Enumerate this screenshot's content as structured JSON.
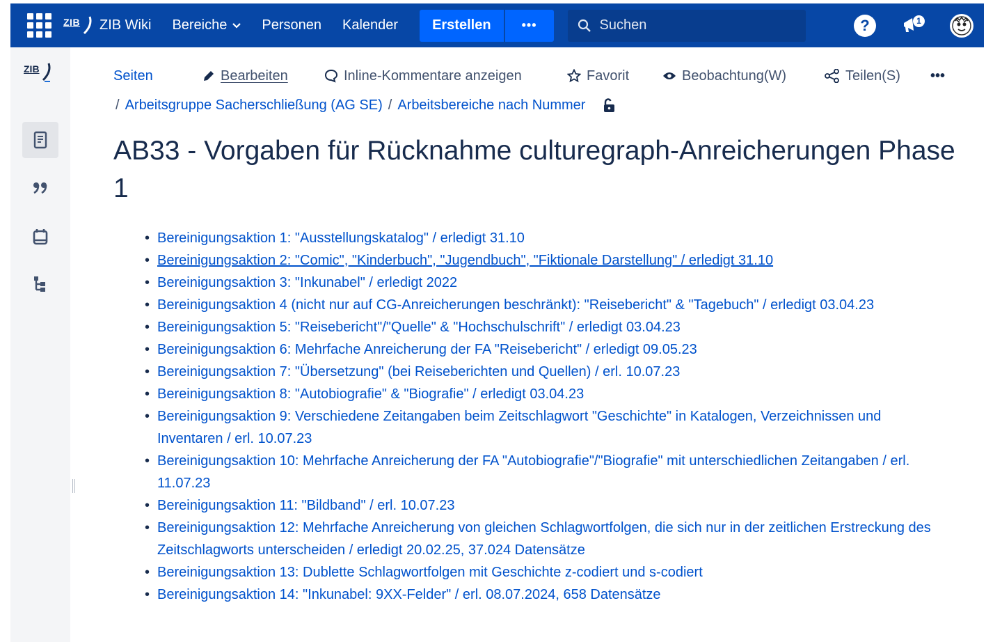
{
  "topnav": {
    "logo_text": "ZIB",
    "site_name": "ZIB Wiki",
    "areas_label": "Bereiche",
    "people_label": "Personen",
    "calendar_label": "Kalender",
    "create_label": "Erstellen",
    "more_label": "•••",
    "search_placeholder": "Suchen",
    "help_label": "?",
    "notification_count": "1",
    "colors": {
      "bar": "#0747a6",
      "create": "#0065ff",
      "search": "#083d8e"
    }
  },
  "sidebar": {
    "logo_text": "ZIB",
    "items": [
      {
        "icon": "pages-icon",
        "active": true
      },
      {
        "icon": "quote-icon",
        "active": false
      },
      {
        "icon": "calendar-icon",
        "active": false
      },
      {
        "icon": "hierarchy-icon",
        "active": false
      }
    ]
  },
  "toolbar": {
    "pages": "Seiten",
    "edit": "Bearbeiten",
    "inline_comments": "Inline-Kommentare anzeigen",
    "favorite": "Favorit",
    "watch": "Beobachtung(W)",
    "share": "Teilen(S)",
    "more": "•••"
  },
  "breadcrumb": {
    "items": [
      "Arbeitsgruppe Sacherschließung (AG SE)",
      "Arbeitsbereiche nach Nummer"
    ]
  },
  "page": {
    "title": "AB33 - Vorgaben für Rücknahme culturegraph-Anreicherungen Phase 1",
    "link_color": "#0052cc"
  },
  "items": [
    "Bereinigungsaktion 1: \"Ausstellungskatalog\" / erledigt 31.10",
    "Bereinigungsaktion 2: \"Comic\", \"Kinderbuch\", \"Jugendbuch\", \"Fiktionale Darstellung\" / erledigt 31.10",
    "Bereinigungsaktion 3: \"Inkunabel\" / erledigt 2022",
    "Bereinigungsaktion 4 (nicht nur auf CG-Anreicherungen beschränkt): \"Reisebericht\" & \"Tagebuch\" / erledigt 03.04.23",
    "Bereinigungsaktion 5: \"Reisebericht\"/\"Quelle\" & \"Hochschulschrift\" / erledigt 03.04.23",
    "Bereinigungsaktion 6: Mehrfache Anreicherung der FA \"Reisebericht\" / erledigt 09.05.23",
    "Bereinigungsaktion 7: \"Übersetzung\" (bei Reiseberichten und Quellen) / erl. 10.07.23",
    "Bereinigungsaktion 8: \"Autobiografie\" & \"Biografie\" / erledigt 03.04.23",
    "Bereinigungsaktion 9: Verschiedene Zeitangaben beim Zeitschlagwort \"Geschichte\" in Katalogen, Verzeichnissen und Inventaren / erl. 10.07.23",
    "Bereinigungsaktion 10: Mehrfache Anreicherung der FA \"Autobiografie\"/\"Biografie\" mit unterschiedlichen Zeitangaben / erl. 11.07.23",
    "Bereinigungsaktion 11: \"Bildband\" / erl. 10.07.23",
    "Bereinigungsaktion 12: Mehrfache Anreicherung von gleichen Schlagwortfolgen, die sich nur in der zeitlichen Erstreckung des Zeitschlagworts unterscheiden / erledigt 20.02.25, 37.024 Datensätze",
    "Bereinigungsaktion 13: Dublette Schlagwortfolgen mit Geschichte z-codiert und s-codiert",
    "Bereinigungsaktion 14: \"Inkunabel: 9XX-Felder\" / erl. 08.07.2024, 658 Datensätze"
  ]
}
